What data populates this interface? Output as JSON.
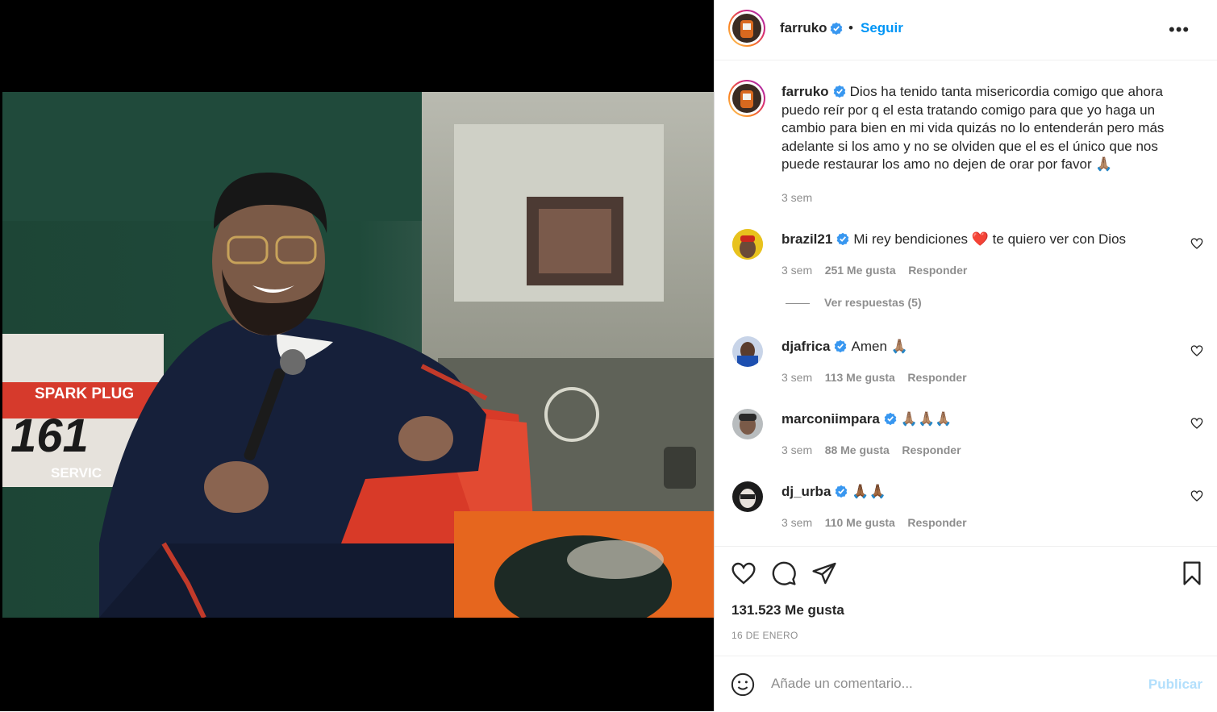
{
  "post": {
    "author": "farruko",
    "follow_label": "Seguir",
    "dot": "•",
    "more_label": "•••"
  },
  "caption": {
    "username": "farruko",
    "text": "Dios ha tenido tanta misericordia comigo que ahora puedo reír por q el esta tratando comigo para que yo haga un cambio para bien en mi vida quizás no lo entenderán pero más adelante si los amo y no se olviden que el es el único que nos puede restaurar los amo no dejen de orar por favor 🙏🏽",
    "time": "3 sem"
  },
  "comments": [
    {
      "username": "brazil21",
      "text": "Mi rey bendiciones ❤️ te quiero ver con Dios",
      "time": "3 sem",
      "likes": "251 Me gusta",
      "reply": "Responder"
    },
    {
      "username": "djafrica",
      "text": "Amen 🙏🏽",
      "time": "3 sem",
      "likes": "113 Me gusta",
      "reply": "Responder"
    },
    {
      "username": "marconiimpara",
      "text": "🙏🏽🙏🏽🙏🏽",
      "time": "3 sem",
      "likes": "88 Me gusta",
      "reply": "Responder"
    },
    {
      "username": "dj_urba",
      "text": "🙏🏾🙏🏾",
      "time": "3 sem",
      "likes": "110 Me gusta",
      "reply": "Responder"
    }
  ],
  "view_replies": "Ver respuestas (5)",
  "photo": {
    "sign_line1": "SPARK  PLUG",
    "sign_line2": "161",
    "sign_line3": "SERVIC"
  },
  "stats": {
    "likes": "131.523 Me gusta",
    "date": "16 DE ENERO"
  },
  "composer": {
    "placeholder": "Añade un comentario...",
    "publish_label": "Publicar"
  },
  "icons": {
    "like": "heart-icon",
    "comment": "comment-icon",
    "share": "share-icon",
    "save": "bookmark-icon",
    "emoji": "emoji-icon",
    "more": "more-options-icon",
    "verified": "verified-badge-icon"
  },
  "colors": {
    "accent": "#0095f6",
    "verified": "#3897f0",
    "muted": "#8e8e8e",
    "publish_disabled": "#b2dffc"
  }
}
